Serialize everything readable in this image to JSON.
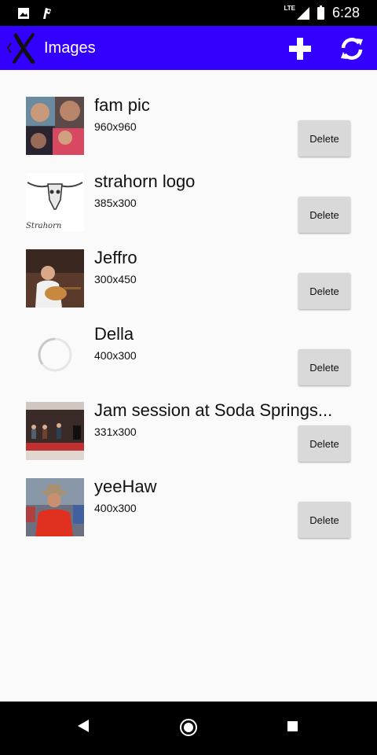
{
  "status_bar": {
    "time": "6:28",
    "network": "LTE"
  },
  "app_bar": {
    "title": "Images"
  },
  "images": [
    {
      "name": "fam pic",
      "dims": "960x960",
      "delete_label": "Delete"
    },
    {
      "name": "strahorn logo",
      "dims": "385x300",
      "delete_label": "Delete",
      "logo_text": "Strahorn"
    },
    {
      "name": "Jeffro",
      "dims": "300x450",
      "delete_label": "Delete"
    },
    {
      "name": "Della",
      "dims": "400x300",
      "delete_label": "Delete"
    },
    {
      "name": "Jam session at Soda Springs...",
      "dims": "331x300",
      "delete_label": "Delete"
    },
    {
      "name": "yeeHaw",
      "dims": "400x300",
      "delete_label": "Delete"
    }
  ],
  "colors": {
    "app_bar": "#3300ff",
    "delete_button": "#d9d9d9"
  }
}
